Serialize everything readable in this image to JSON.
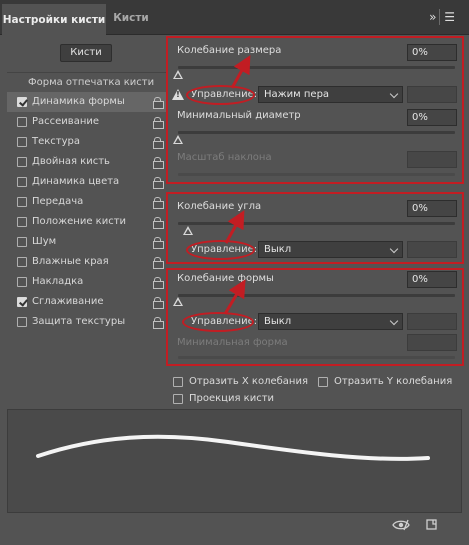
{
  "tabs": [
    {
      "label": "Настройки кисти"
    },
    {
      "label": "Кисти"
    }
  ],
  "panel_menu_icon": "double-chevron-right-and-menu-icon",
  "brushes_button": "Кисти",
  "left_list": {
    "header": "Форма отпечатка кисти",
    "items": [
      {
        "label": "Динамика формы",
        "checked": true,
        "selected": true
      },
      {
        "label": "Рассеивание",
        "checked": false
      },
      {
        "label": "Текстура",
        "checked": false
      },
      {
        "label": "Двойная кисть",
        "checked": false
      },
      {
        "label": "Динамика цвета",
        "checked": false
      },
      {
        "label": "Передача",
        "checked": false
      },
      {
        "label": "Положение кисти",
        "checked": false
      },
      {
        "label": "Шум",
        "checked": false
      },
      {
        "label": "Влажные края",
        "checked": false
      },
      {
        "label": "Накладка",
        "checked": false
      },
      {
        "label": "Сглаживание",
        "checked": true
      },
      {
        "label": "Защита текстуры",
        "checked": false
      }
    ]
  },
  "section_size": {
    "jitter_label": "Колебание размера",
    "jitter_value": "0%",
    "control_label": "Управление:",
    "control_value": "Нажим пера",
    "min_diameter_label": "Минимальный диаметр",
    "min_diameter_value": "0%",
    "tilt_scale_label": "Масштаб наклона"
  },
  "section_angle": {
    "jitter_label": "Колебание угла",
    "jitter_value": "0%",
    "control_label": "Управление:",
    "control_value": "Выкл"
  },
  "section_roundness": {
    "jitter_label": "Колебание формы",
    "jitter_value": "0%",
    "control_label": "Управление:",
    "control_value": "Выкл",
    "min_roundness_label": "Минимальная форма"
  },
  "options": {
    "flip_x": "Отразить X колебания",
    "flip_y": "Отразить Y колебания",
    "projection": "Проекция кисти"
  },
  "colors": {
    "annotation_red": "#c21d23",
    "panel_bg": "#535353"
  }
}
